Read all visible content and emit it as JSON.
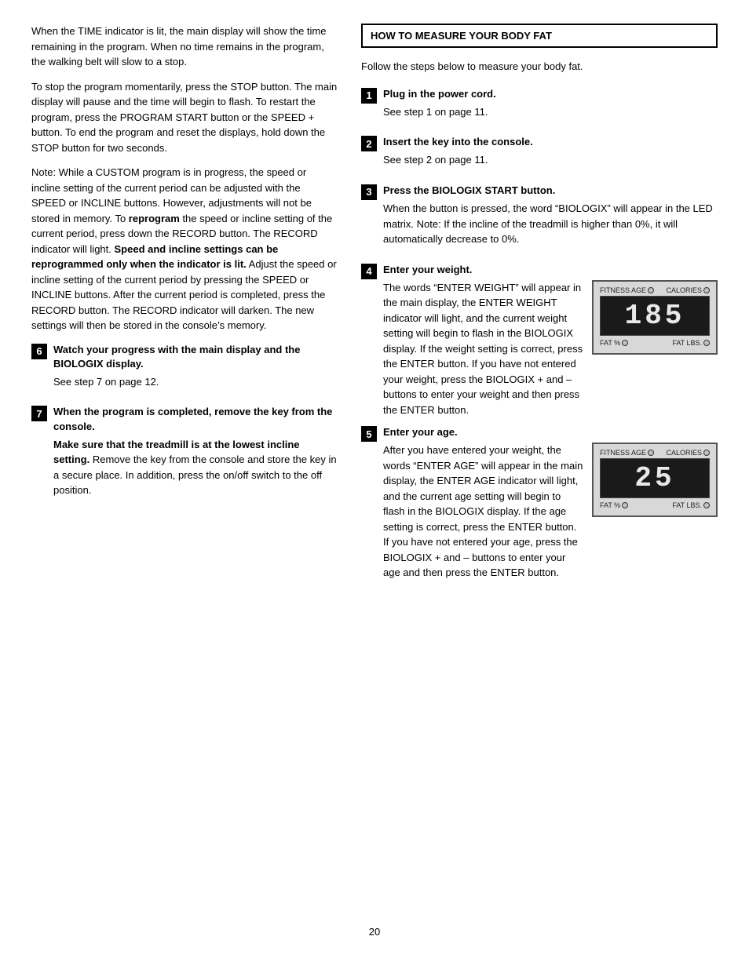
{
  "page": {
    "number": "20"
  },
  "left": {
    "para1": "When the TIME indicator is lit, the main display will show the time remaining in the program. When no time remains in the program, the walking belt will slow to a stop.",
    "para2": "To stop the program momentarily, press the STOP button. The main display will pause and the time will begin to flash. To restart the program, press the PROGRAM START button or the SPEED + button. To end the program and reset the displays, hold down the STOP button for two seconds.",
    "para3_pre": "Note: While a CUSTOM program is in progress, the speed or incline setting of the current period can be adjusted with the SPEED or INCLINE buttons. However, adjustments will not be stored in memory. To ",
    "para3_bold": "reprogram",
    "para3_post": " the speed or incline setting of the current period, press down the RECORD button. The RECORD indicator will light. ",
    "para3_bold2": "Speed and incline settings can be reprogrammed only when the indicator is lit.",
    "para3_end": " Adjust the speed or incline setting of the current period by pressing the SPEED or INCLINE buttons. After the current period is completed, press the RECORD button. The RECORD indicator will darken. The new settings will then be stored in the console’s memory.",
    "step6": {
      "number": "6",
      "title": "Watch your progress with the main display and the BIOLOGIX display.",
      "body": "See step 7 on page 12."
    },
    "step7": {
      "number": "7",
      "title": "When the program is completed, remove the key from the console.",
      "body_bold": "Make sure that the treadmill is at the lowest incline setting.",
      "body": " Remove the key from the console and store the key in a secure place. In addition, press the on/off switch to the off position."
    }
  },
  "right": {
    "section_title": "HOW TO MEASURE YOUR BODY FAT",
    "intro": "Follow the steps below to measure your body fat.",
    "steps": [
      {
        "number": "1",
        "title": "Plug in the power cord.",
        "body": "See step 1 on page 11.",
        "has_display": false
      },
      {
        "number": "2",
        "title": "Insert the key into the console.",
        "body": "See step 2 on page 11.",
        "has_display": false
      },
      {
        "number": "3",
        "title": "Press the BIOLOGIX START button.",
        "body": "When the button is pressed, the word “BIOLOGIX” will appear in the LED matrix. Note: If the incline of the treadmill is higher than 0%, it will automatically decrease to 0%.",
        "has_display": false
      },
      {
        "number": "4",
        "title": "Enter your weight.",
        "body_pre": "The words “ENTER WEIGHT” will appear in the main display, the ENTER WEIGHT indicator will light, and the current weight setting will ",
        "body_post": "begin to flash in the BIOLOGIX display. If the weight setting is correct, press the ENTER button. If you have not entered your weight, press the BIOLOGIX + and – buttons to enter your weight and then press the ENTER button.",
        "has_display": true,
        "display_value": "185",
        "display_top_left": "FITNESS AGE",
        "display_top_right": "CALORIES",
        "display_bottom_left": "FAT %",
        "display_bottom_right": "FAT LBS."
      },
      {
        "number": "5",
        "title": "Enter your age.",
        "body_pre": "After you have entered your weight, the words “ENTER AGE” will appear in the main display, the ENTER AGE indicator will light, and ",
        "body_post": "the current age setting will begin to flash in the BIOLOGIX display. If the age setting is correct, press the ENTER button. If you have not entered your age, press the BIOLOGIX + and – buttons to enter your age and then press the ENTER button.",
        "has_display": true,
        "display_value": "25",
        "display_top_left": "FITNESS AGE",
        "display_top_right": "CALORIES",
        "display_bottom_left": "FAT %",
        "display_bottom_right": "FAT LBS."
      }
    ]
  }
}
